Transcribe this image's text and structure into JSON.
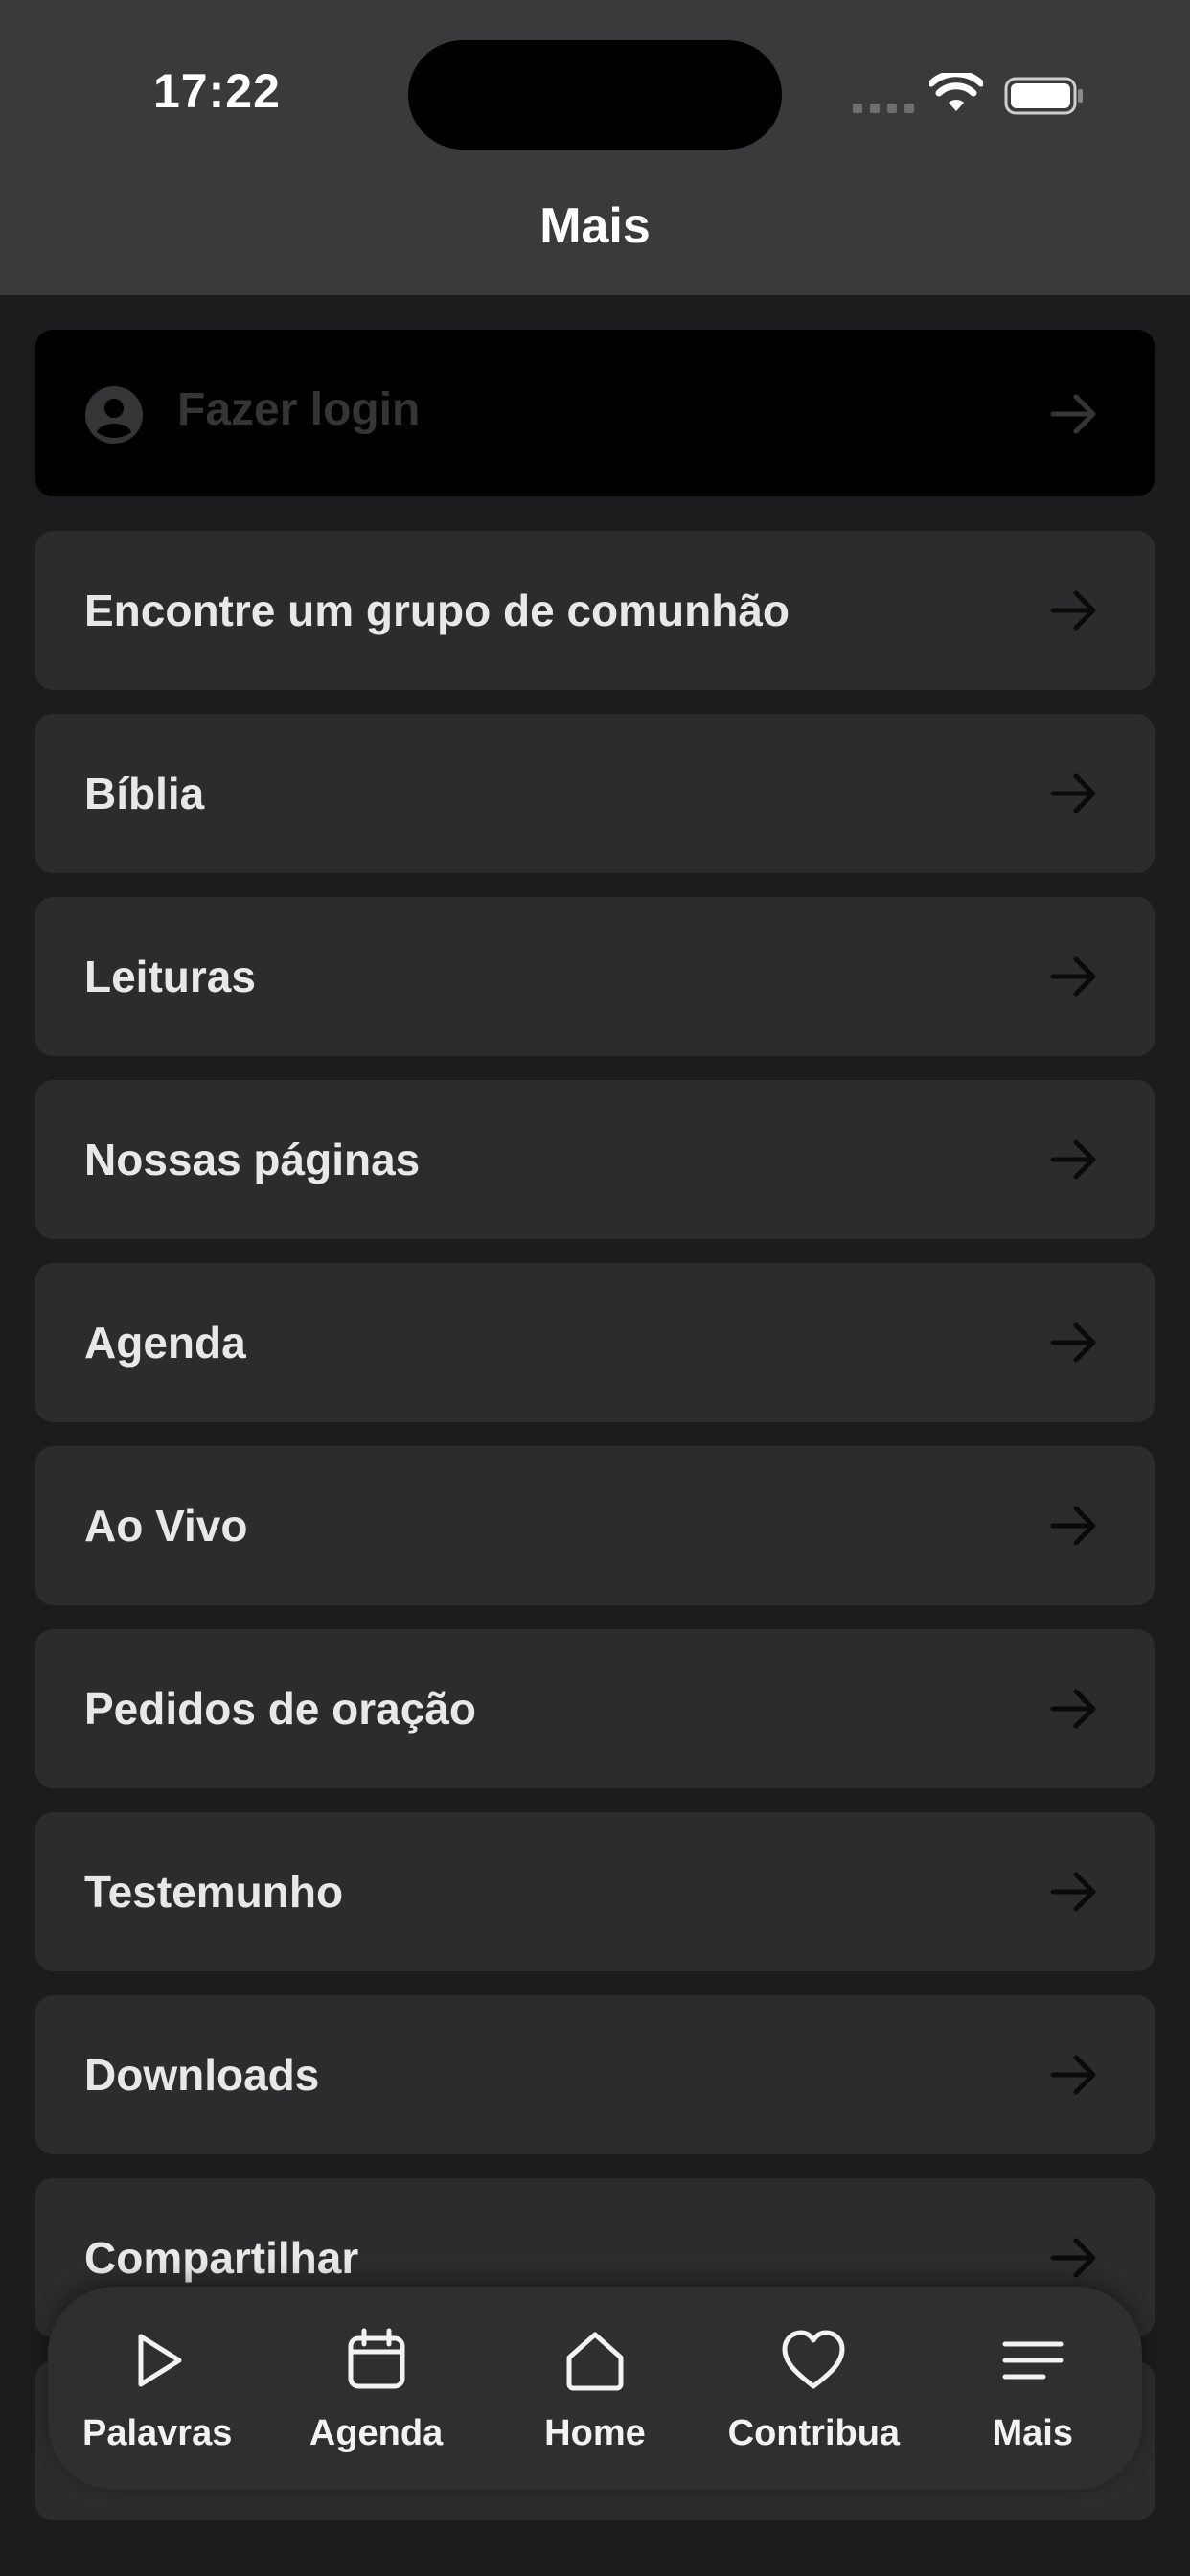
{
  "status_bar": {
    "time": "17:22"
  },
  "header": {
    "title": "Mais"
  },
  "login": {
    "label": "Fazer login",
    "icon": "person-circle-icon"
  },
  "menu": {
    "items": [
      {
        "label": "Encontre um grupo de comunhão"
      },
      {
        "label": "Bíblia"
      },
      {
        "label": "Leituras"
      },
      {
        "label": "Nossas páginas"
      },
      {
        "label": "Agenda"
      },
      {
        "label": "Ao Vivo"
      },
      {
        "label": "Pedidos de oração"
      },
      {
        "label": "Testemunho"
      },
      {
        "label": "Downloads"
      },
      {
        "label": "Compartilhar"
      },
      {
        "label": ""
      }
    ]
  },
  "tabbar": {
    "tabs": [
      {
        "label": "Palavras",
        "icon": "play-icon"
      },
      {
        "label": "Agenda",
        "icon": "calendar-icon"
      },
      {
        "label": "Home",
        "icon": "home-icon"
      },
      {
        "label": "Contribua",
        "icon": "heart-icon"
      },
      {
        "label": "Mais",
        "icon": "menu-icon"
      }
    ]
  },
  "colors": {
    "background": "#1c1c1e",
    "header": "#3a3a3c",
    "card": "#2c2c2e",
    "login_card": "#000000",
    "tabbar": "#2f2f31"
  }
}
